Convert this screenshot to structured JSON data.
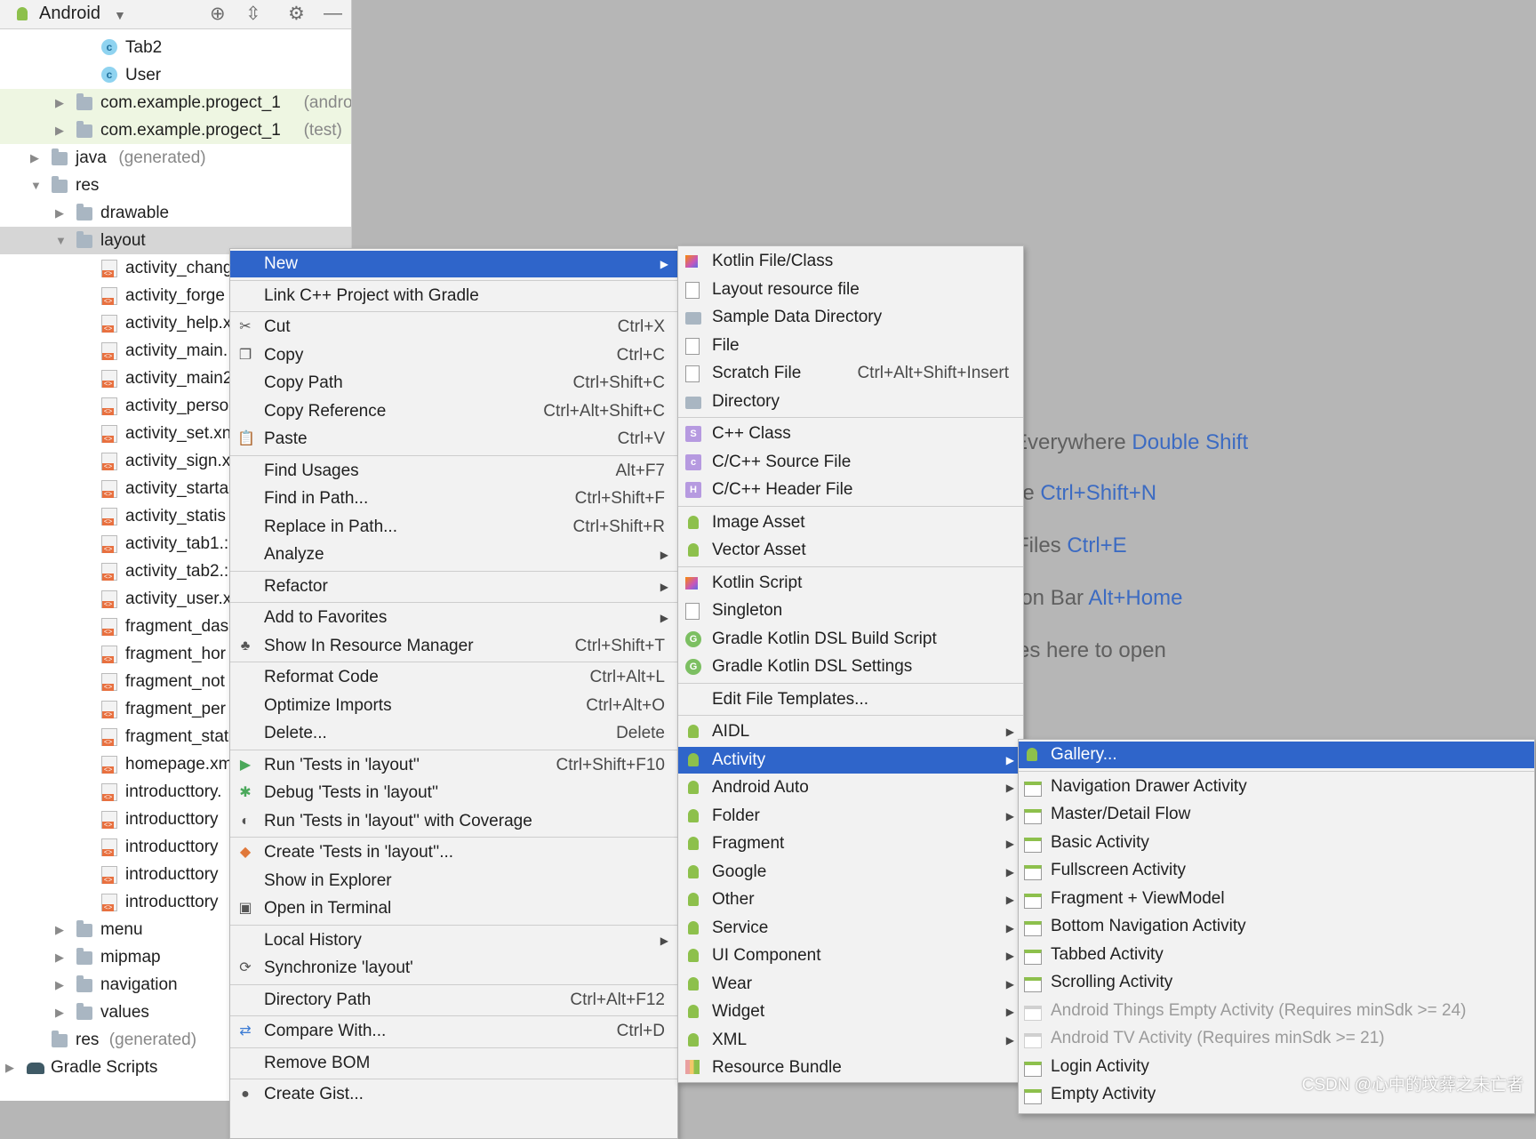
{
  "project_panel": {
    "view_selector": "Android",
    "tree": [
      {
        "label": "Tab2",
        "icon": "class-icon",
        "indent": 2
      },
      {
        "label": "User",
        "icon": "class-icon",
        "indent": 2
      },
      {
        "label": "com.example.progect_1",
        "suffix": "(androic",
        "icon": "package-icon",
        "indent": 1,
        "collapsed": true,
        "green": true
      },
      {
        "label": "com.example.progect_1",
        "suffix": "(test)",
        "icon": "package-icon",
        "indent": 1,
        "collapsed": true,
        "green": true
      },
      {
        "label": "java",
        "suffix": "(generated)",
        "icon": "java-folder-icon",
        "indent": 0,
        "collapsed": true
      },
      {
        "label": "res",
        "icon": "res-folder-icon",
        "indent": 0,
        "expanded": true
      },
      {
        "label": "drawable",
        "icon": "folder-icon",
        "indent": 1,
        "collapsed": true
      },
      {
        "label": "layout",
        "icon": "folder-icon",
        "indent": 1,
        "expanded": true,
        "selected": true
      },
      {
        "label": "activity_chang",
        "icon": "xml-icon",
        "indent": 2
      },
      {
        "label": "activity_forge",
        "icon": "xml-icon",
        "indent": 2
      },
      {
        "label": "activity_help.x",
        "icon": "xml-icon",
        "indent": 2
      },
      {
        "label": "activity_main.",
        "icon": "xml-icon",
        "indent": 2
      },
      {
        "label": "activity_main2",
        "icon": "xml-icon",
        "indent": 2
      },
      {
        "label": "activity_perso",
        "icon": "xml-icon",
        "indent": 2
      },
      {
        "label": "activity_set.xn",
        "icon": "xml-icon",
        "indent": 2
      },
      {
        "label": "activity_sign.x",
        "icon": "xml-icon",
        "indent": 2
      },
      {
        "label": "activity_starta",
        "icon": "xml-icon",
        "indent": 2
      },
      {
        "label": "activity_statis",
        "icon": "xml-icon",
        "indent": 2
      },
      {
        "label": "activity_tab1.:",
        "icon": "xml-icon",
        "indent": 2
      },
      {
        "label": "activity_tab2.:",
        "icon": "xml-icon",
        "indent": 2
      },
      {
        "label": "activity_user.x",
        "icon": "xml-icon",
        "indent": 2
      },
      {
        "label": "fragment_das",
        "icon": "xml-icon",
        "indent": 2
      },
      {
        "label": "fragment_hor",
        "icon": "xml-icon",
        "indent": 2
      },
      {
        "label": "fragment_not",
        "icon": "xml-icon",
        "indent": 2
      },
      {
        "label": "fragment_per",
        "icon": "xml-icon",
        "indent": 2
      },
      {
        "label": "fragment_stat",
        "icon": "xml-icon",
        "indent": 2
      },
      {
        "label": "homepage.xm",
        "icon": "xml-icon",
        "indent": 2
      },
      {
        "label": "introducttory.",
        "icon": "xml-icon",
        "indent": 2
      },
      {
        "label": "introducttory",
        "icon": "xml-icon",
        "indent": 2
      },
      {
        "label": "introducttory",
        "icon": "xml-icon",
        "indent": 2
      },
      {
        "label": "introducttory",
        "icon": "xml-icon",
        "indent": 2
      },
      {
        "label": "introducttory",
        "icon": "xml-icon",
        "indent": 2
      },
      {
        "label": "menu",
        "icon": "folder-icon",
        "indent": 1,
        "collapsed": true
      },
      {
        "label": "mipmap",
        "icon": "folder-icon",
        "indent": 1,
        "collapsed": true
      },
      {
        "label": "navigation",
        "icon": "folder-icon",
        "indent": 1,
        "collapsed": true
      },
      {
        "label": "values",
        "icon": "folder-icon",
        "indent": 1,
        "collapsed": true
      },
      {
        "label": "res",
        "suffix": "(generated)",
        "icon": "res-folder-icon",
        "indent": 0
      },
      {
        "label": "Gradle Scripts",
        "icon": "gradle-icon",
        "indent": -1,
        "collapsed": true
      }
    ]
  },
  "editor_hints": [
    {
      "text": "Everywhere ",
      "key": "Double Shift"
    },
    {
      "text": "le ",
      "key": "Ctrl+Shift+N"
    },
    {
      "text": "Files ",
      "key": "Ctrl+E"
    },
    {
      "text": "ion Bar ",
      "key": "Alt+Home"
    },
    {
      "text": "es here to open",
      "key": ""
    }
  ],
  "context_menu": {
    "items": [
      {
        "label": "New",
        "submenu": true,
        "highlight": true
      },
      {
        "label": "Link C++ Project with Gradle",
        "sep_before": true
      },
      {
        "label": "Cut",
        "shortcut": "Ctrl+X",
        "icon": "scissors-icon",
        "sep_before": true
      },
      {
        "label": "Copy",
        "shortcut": "Ctrl+C",
        "icon": "copy-icon"
      },
      {
        "label": "Copy Path",
        "shortcut": "Ctrl+Shift+C"
      },
      {
        "label": "Copy Reference",
        "shortcut": "Ctrl+Alt+Shift+C"
      },
      {
        "label": "Paste",
        "shortcut": "Ctrl+V",
        "icon": "paste-icon"
      },
      {
        "label": "Find Usages",
        "shortcut": "Alt+F7",
        "sep_before": true
      },
      {
        "label": "Find in Path...",
        "shortcut": "Ctrl+Shift+F"
      },
      {
        "label": "Replace in Path...",
        "shortcut": "Ctrl+Shift+R"
      },
      {
        "label": "Analyze",
        "submenu": true
      },
      {
        "label": "Refactor",
        "submenu": true,
        "sep_before": true
      },
      {
        "label": "Add to Favorites",
        "submenu": true,
        "sep_before": true
      },
      {
        "label": "Show In Resource Manager",
        "shortcut": "Ctrl+Shift+T",
        "icon": "resource-manager-icon"
      },
      {
        "label": "Reformat Code",
        "shortcut": "Ctrl+Alt+L",
        "sep_before": true
      },
      {
        "label": "Optimize Imports",
        "shortcut": "Ctrl+Alt+O"
      },
      {
        "label": "Delete...",
        "shortcut": "Delete"
      },
      {
        "label": "Run 'Tests in 'layout''",
        "shortcut": "Ctrl+Shift+F10",
        "icon": "run-icon",
        "sep_before": true
      },
      {
        "label": "Debug 'Tests in 'layout''",
        "icon": "debug-icon"
      },
      {
        "label": "Run 'Tests in 'layout'' with Coverage",
        "icon": "coverage-icon"
      },
      {
        "label": "Create 'Tests in 'layout''...",
        "icon": "create-test-icon",
        "sep_before": true
      },
      {
        "label": "Show in Explorer"
      },
      {
        "label": "Open in Terminal",
        "icon": "terminal-icon"
      },
      {
        "label": "Local History",
        "submenu": true,
        "sep_before": true
      },
      {
        "label": "Synchronize 'layout'",
        "icon": "sync-icon"
      },
      {
        "label": "Directory Path",
        "shortcut": "Ctrl+Alt+F12",
        "sep_before": true
      },
      {
        "label": "Compare With...",
        "shortcut": "Ctrl+D",
        "icon": "compare-icon",
        "sep_before": true
      },
      {
        "label": "Remove BOM",
        "sep_before": true
      },
      {
        "label": "Create Gist...",
        "icon": "github-icon",
        "sep_before": true
      }
    ]
  },
  "new_submenu": {
    "items": [
      {
        "label": "Kotlin File/Class",
        "icon": "kotlin-file-icon"
      },
      {
        "label": "Layout resource file",
        "icon": "layout-file-icon"
      },
      {
        "label": "Sample Data Directory",
        "icon": "folder-icon"
      },
      {
        "label": "File",
        "icon": "file-icon"
      },
      {
        "label": "Scratch File",
        "shortcut": "Ctrl+Alt+Shift+Insert",
        "icon": "scratch-file-icon"
      },
      {
        "label": "Directory",
        "icon": "folder-icon"
      },
      {
        "label": "C++ Class",
        "icon": "cpp-class-icon",
        "sep_before": true
      },
      {
        "label": "C/C++ Source File",
        "icon": "cpp-source-icon"
      },
      {
        "label": "C/C++ Header File",
        "icon": "cpp-header-icon"
      },
      {
        "label": "Image Asset",
        "icon": "android-icon",
        "sep_before": true
      },
      {
        "label": "Vector Asset",
        "icon": "android-icon"
      },
      {
        "label": "Kotlin Script",
        "icon": "kotlin-script-icon",
        "sep_before": true
      },
      {
        "label": "Singleton",
        "icon": "singleton-icon"
      },
      {
        "label": "Gradle Kotlin DSL Build Script",
        "icon": "gradle-g-icon"
      },
      {
        "label": "Gradle Kotlin DSL Settings",
        "icon": "gradle-g-icon"
      },
      {
        "label": "Edit File Templates...",
        "sep_before": true
      },
      {
        "label": "AIDL",
        "icon": "android-icon",
        "submenu": true,
        "sep_before": true
      },
      {
        "label": "Activity",
        "icon": "android-icon",
        "submenu": true,
        "highlight": true
      },
      {
        "label": "Android Auto",
        "icon": "android-icon",
        "submenu": true
      },
      {
        "label": "Folder",
        "icon": "android-icon",
        "submenu": true
      },
      {
        "label": "Fragment",
        "icon": "android-icon",
        "submenu": true
      },
      {
        "label": "Google",
        "icon": "android-icon",
        "submenu": true
      },
      {
        "label": "Other",
        "icon": "android-icon",
        "submenu": true
      },
      {
        "label": "Service",
        "icon": "android-icon",
        "submenu": true
      },
      {
        "label": "UI Component",
        "icon": "android-icon",
        "submenu": true
      },
      {
        "label": "Wear",
        "icon": "android-icon",
        "submenu": true
      },
      {
        "label": "Widget",
        "icon": "android-icon",
        "submenu": true
      },
      {
        "label": "XML",
        "icon": "android-icon",
        "submenu": true
      },
      {
        "label": "Resource Bundle",
        "icon": "resource-bundle-icon"
      }
    ]
  },
  "activity_submenu": {
    "items": [
      {
        "label": "Gallery...",
        "icon": "android-icon",
        "highlight": true
      },
      {
        "label": "Navigation Drawer Activity",
        "icon": "template-icon",
        "sep_before": true
      },
      {
        "label": "Master/Detail Flow",
        "icon": "template-icon"
      },
      {
        "label": "Basic Activity",
        "icon": "template-icon"
      },
      {
        "label": "Fullscreen Activity",
        "icon": "template-icon"
      },
      {
        "label": "Fragment + ViewModel",
        "icon": "template-icon"
      },
      {
        "label": "Bottom Navigation Activity",
        "icon": "template-icon"
      },
      {
        "label": "Tabbed Activity",
        "icon": "template-icon"
      },
      {
        "label": "Scrolling Activity",
        "icon": "template-icon"
      },
      {
        "label": "Android Things Empty Activity (Requires minSdk >= 24)",
        "icon": "template-icon",
        "disabled": true
      },
      {
        "label": "Android TV Activity (Requires minSdk >= 21)",
        "icon": "template-icon",
        "disabled": true
      },
      {
        "label": "Login Activity",
        "icon": "template-icon"
      },
      {
        "label": "Empty Activity",
        "icon": "template-icon"
      }
    ]
  },
  "watermark": "CSDN @心中的坟葬之未亡者",
  "colors": {
    "highlight": "#2f65ca",
    "key_hint": "#3c6bc2",
    "android_green": "#8dc04c"
  }
}
